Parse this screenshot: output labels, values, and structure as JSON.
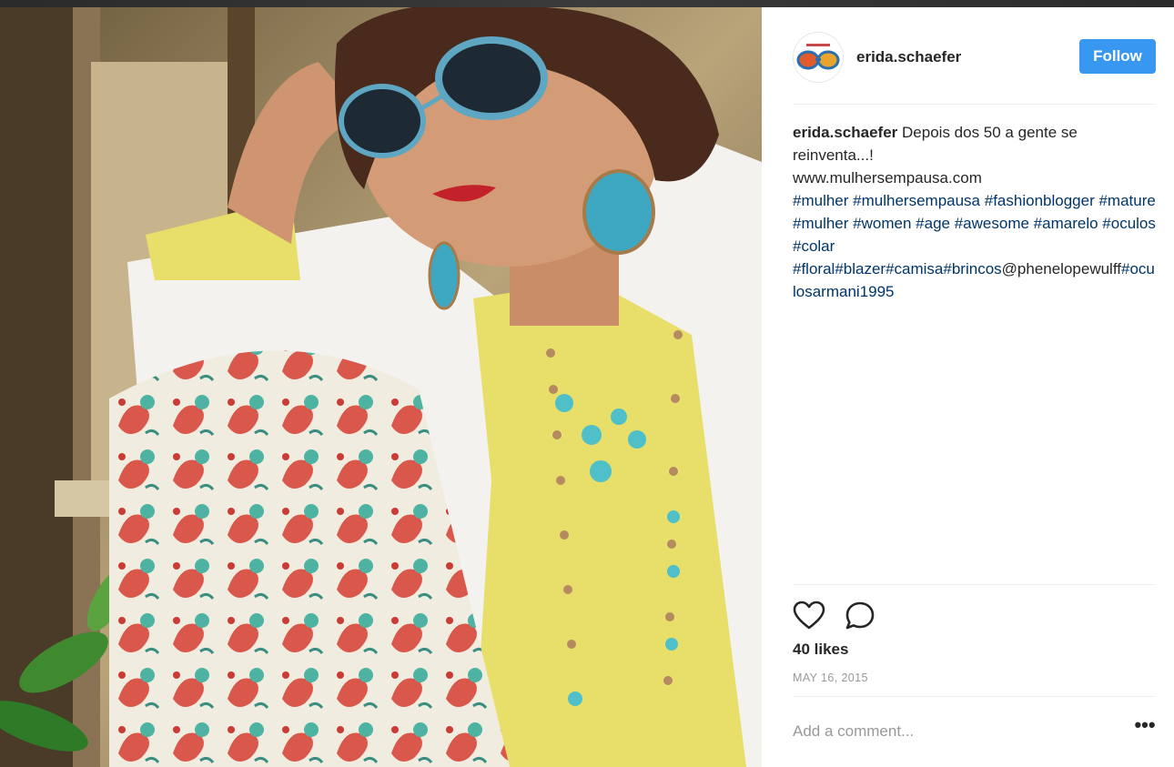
{
  "post": {
    "username": "erida.schaefer",
    "follow_label": "Follow",
    "caption": {
      "username": "erida.schaefer",
      "text": "Depois dos 50 a gente se reinventa...!",
      "url": "www.mulhersempausa.com",
      "tags": [
        "#mulher",
        "#mulhersempausa",
        "#fashionblogger",
        "#mature",
        "#mulher",
        "#women",
        "#age",
        "#awesome",
        "#amarelo",
        "#oculos",
        "#colar",
        "#floral",
        "#blazer",
        "#camisa",
        "#brincos"
      ],
      "mention": "@phenelopewulff",
      "last_tag": "#oculosarmani1995"
    },
    "likes": "40 likes",
    "date": "MAY 16, 2015",
    "comment_placeholder": "Add a comment...",
    "more_label": "•••"
  },
  "icons": {
    "like": "heart-icon",
    "comment": "comment-icon",
    "more": "more-options-icon"
  },
  "colors": {
    "follow_bg": "#3897f0",
    "hashtag": "#003569",
    "muted": "#999999",
    "text": "#262626"
  }
}
